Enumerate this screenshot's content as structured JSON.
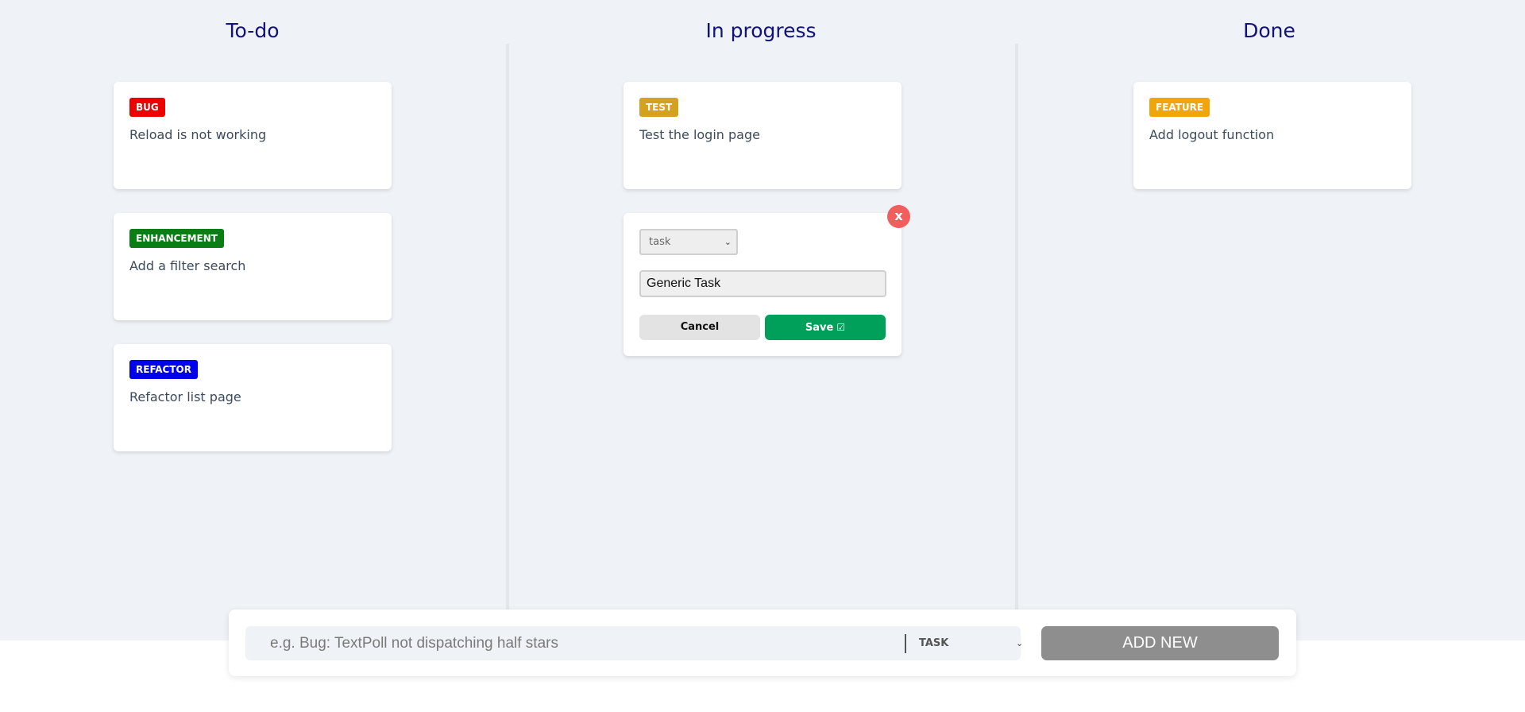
{
  "columns": {
    "todo": {
      "title": "To-do"
    },
    "progress": {
      "title": "In progress"
    },
    "done": {
      "title": "Done"
    }
  },
  "cards": {
    "todo": [
      {
        "tag": "BUG",
        "text": "Reload is not working"
      },
      {
        "tag": "ENHANCEMENT",
        "text": "Add a filter search"
      },
      {
        "tag": "REFACTOR",
        "text": "Refactor list page"
      }
    ],
    "progress": [
      {
        "tag": "TEST",
        "text": "Test the login page"
      }
    ],
    "done": [
      {
        "tag": "FEATURE",
        "text": "Add logout function"
      }
    ]
  },
  "tag_colors": {
    "BUG": "#ee0000",
    "ENHANCEMENT": "#0a7d14",
    "REFACTOR": "#0000ee",
    "TEST": "#d4a21e",
    "FEATURE": "#f2a50a"
  },
  "edit_card": {
    "close_label": "x",
    "type_value": "task",
    "input_value": "Generic Task",
    "cancel_label": "Cancel",
    "save_label": "Save",
    "save_icon": "check-square-icon"
  },
  "add_bar": {
    "placeholder": "e.g. Bug: TextPoll not dispatching half stars",
    "type_value": "TASK",
    "button_label": "ADD NEW"
  },
  "colors": {
    "board_bg": "#eff2f7",
    "column_title": "#12127a",
    "save_green": "#00a05a",
    "close_red": "#f25d5d",
    "add_button_gray": "#8e8e8e"
  }
}
